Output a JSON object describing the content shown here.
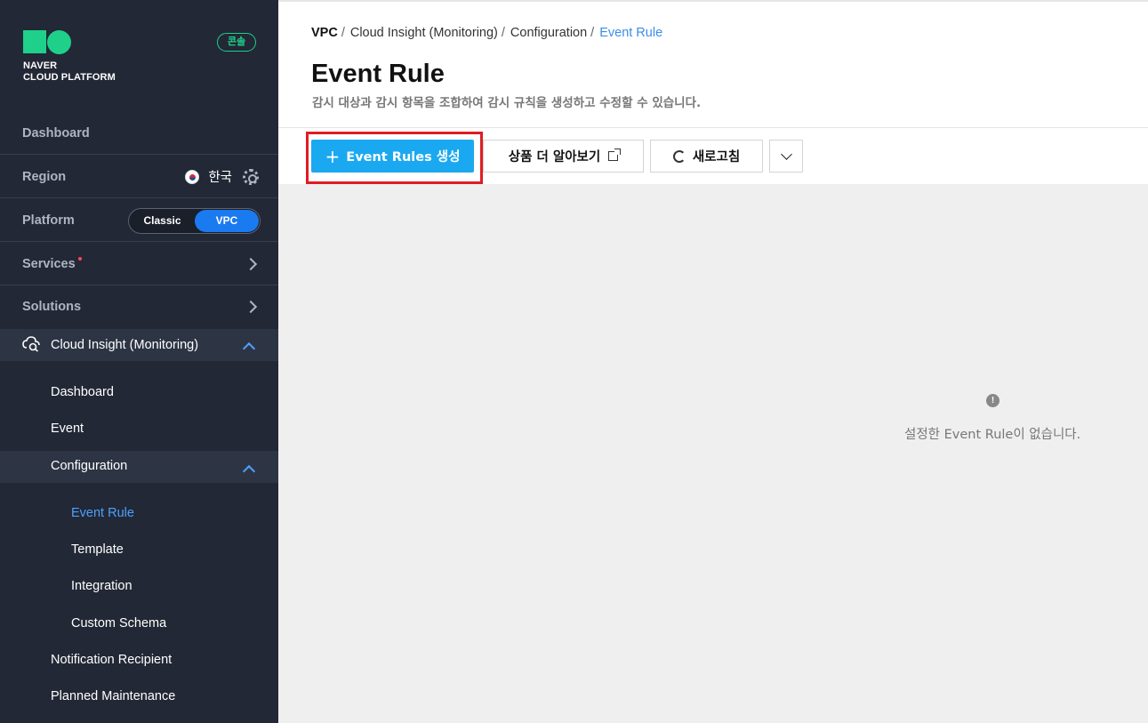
{
  "brand": {
    "line1": "NAVER",
    "line2": "CLOUD PLATFORM",
    "console_badge": "콘솔",
    "brand_color": "#1fd08b"
  },
  "sidebar": {
    "dashboard": "Dashboard",
    "region_label": "Region",
    "region_value": "한국",
    "platform_label": "Platform",
    "platform_options": [
      "Classic",
      "VPC"
    ],
    "platform_selected": "VPC",
    "services": "Services",
    "solutions": "Solutions",
    "cloud_insight": "Cloud Insight (Monitoring)",
    "ci_items": {
      "dashboard": "Dashboard",
      "event": "Event",
      "configuration": "Configuration",
      "config_items": [
        "Event Rule",
        "Template",
        "Integration",
        "Custom Schema"
      ],
      "notification": "Notification Recipient",
      "maintenance": "Planned Maintenance"
    },
    "active_item": "Event Rule"
  },
  "breadcrumb": [
    "VPC",
    "Cloud Insight (Monitoring)",
    "Configuration",
    "Event Rule"
  ],
  "page": {
    "title": "Event Rule",
    "description": "감시 대상과 감시 항목을 조합하여 감시 규칙을 생성하고 수정할 수 있습니다."
  },
  "toolbar": {
    "create_label": "Event Rules 생성",
    "learn_more_label": "상품 더 알아보기",
    "refresh_label": "새로고침"
  },
  "empty_state": {
    "icon": "!",
    "message": "설정한 Event Rule이 없습니다."
  },
  "colors": {
    "accent": "#1aa9f0",
    "active_link": "#4ea0ff",
    "highlight": "#e01c24",
    "sidebar_bg": "#222835"
  }
}
